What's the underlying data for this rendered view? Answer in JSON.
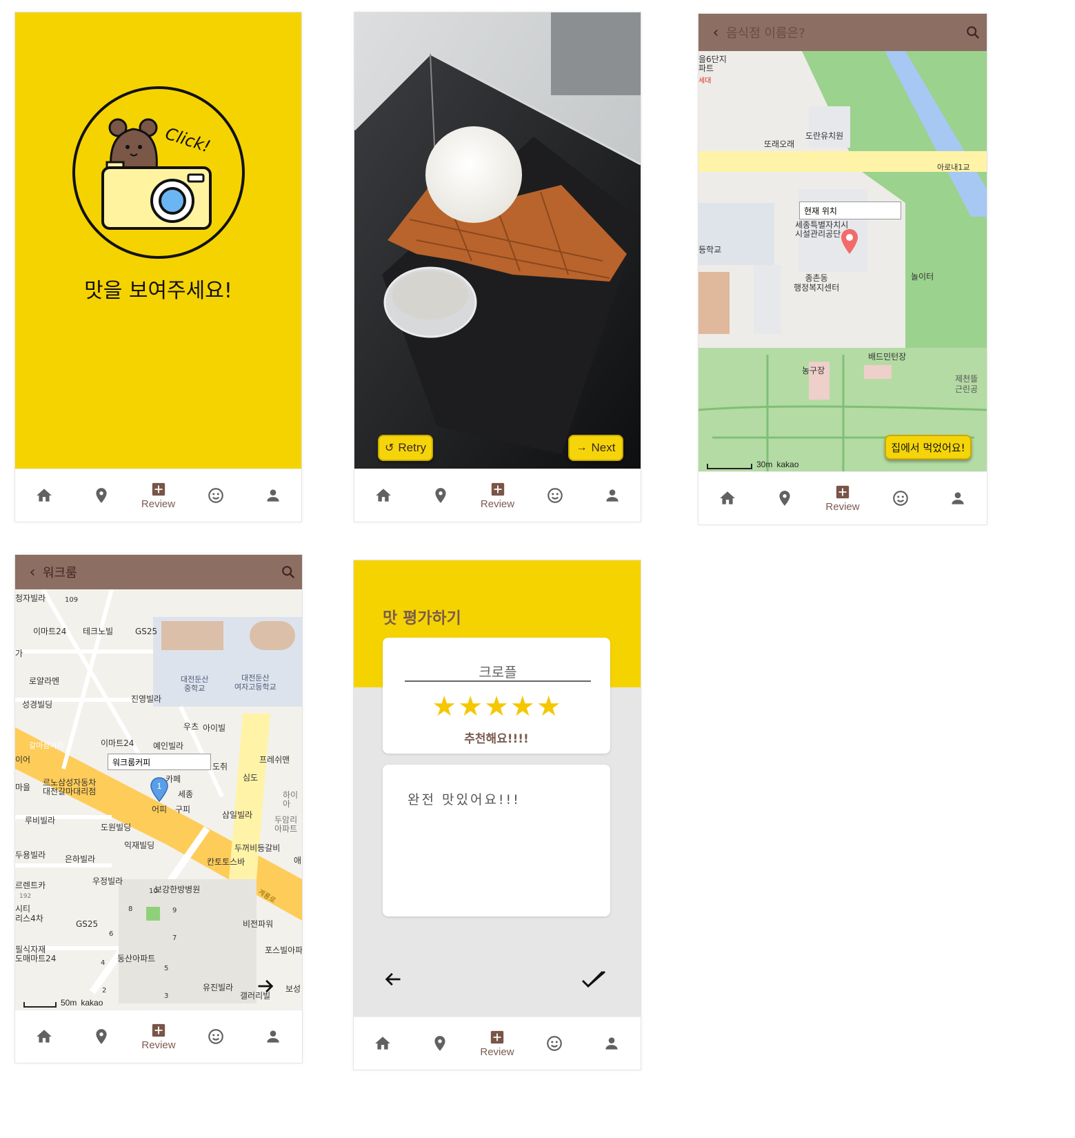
{
  "colors": {
    "brand_yellow": "#f5d50a",
    "brand_brown": "#8d6e63",
    "dark_brown": "#3e2723",
    "map_green": "#9bd28e",
    "road_yellow": "#fecc58"
  },
  "nav": {
    "items": [
      {
        "icon": "home-icon"
      },
      {
        "icon": "location-pin-icon"
      },
      {
        "icon": "add-review-icon",
        "label": "Review"
      },
      {
        "icon": "smiley-icon"
      },
      {
        "icon": "person-icon"
      }
    ]
  },
  "screen1": {
    "badge_text": "Click!",
    "headline": "맛을 보여주세요!"
  },
  "screen2": {
    "retry_label": "Retry",
    "next_label": "Next"
  },
  "screen3": {
    "search_placeholder": "음식점 이름은?",
    "popup": "현재 위치",
    "home_button": "집에서 먹었어요!",
    "scale": "30m",
    "provider": "kakao",
    "labels": {
      "apt": "을6단지\n파트",
      "apt_sub": "세대",
      "l1": "또래오래",
      "l2": "도란유치원",
      "l3": "아로내1교",
      "l4": "세종특별자치시\n시설관리공단",
      "l5": "등학교",
      "l6": "종촌동\n행정복지센터",
      "l7": "놀이터",
      "l8": "배드민턴장",
      "l9": "농구장",
      "l10": "제천뜰\n근린공"
    }
  },
  "screen4": {
    "search_value": "워크룸",
    "popup": "워크룸커피",
    "scale": "50m",
    "provider": "kakao",
    "labels": {
      "a1": "청자빌라",
      "a2": "109",
      "a3": "이마트24",
      "a4": "테크노빌",
      "a5": "GS25",
      "a6": "가",
      "a7": "로얄라멘",
      "a8": "대전둔산\n중학교",
      "a9": "대전둔산\n여자고등학교",
      "a10": "성경빌딩",
      "a11": "진영빌라",
      "a12": "우츠",
      "a13": "아이빌",
      "a14": "갈마삼거리",
      "a15": "이마트24",
      "a16": "예인빌라",
      "a17": "도취",
      "a18": "프레쉬맨",
      "a19": "심도",
      "a20": "르노삼성자동차\n대전갈마대리점",
      "a21": "카페",
      "a22": "세종",
      "a23": "어피",
      "a24": "구피",
      "a25": "루비빌라",
      "a26": "삼일빌라",
      "a27": "도원빌딩",
      "a28": "익재빌딩",
      "a29": "두꺼비등갈비",
      "a30": "두용빌라",
      "a31": "은하빌라",
      "a32": "칸토토스바",
      "a33": "르렌트카",
      "a34": "우정빌라",
      "a35": "보강한방병원",
      "a36": "시티\n리스4차",
      "a37": "GS25",
      "a38": "계룡로",
      "a39": "비전파워",
      "a40": "필식자재\n도매마트24",
      "a41": "동산아파트",
      "a42": "포스빌아파",
      "a43": "유진빌라",
      "a44": "갤러리빌",
      "a45": "보성",
      "a46": "하이\n아",
      "a47": "두암리\n아파트",
      "a48": "애",
      "a49": "이어",
      "a50": "마을",
      "a51": "192",
      "n1": "10",
      "n2": "8",
      "n3": "9",
      "n4": "7",
      "n5": "6",
      "n6": "5",
      "n7": "4",
      "n8": "2",
      "n9": "3",
      "pin_number": "1"
    }
  },
  "screen5": {
    "title": "맛 평가하기",
    "food_name": "크로플",
    "stars": 5,
    "star_glyph": "★",
    "rating_text": "추천해요!!!!",
    "review_text": "완전 맛있어요!!!"
  }
}
